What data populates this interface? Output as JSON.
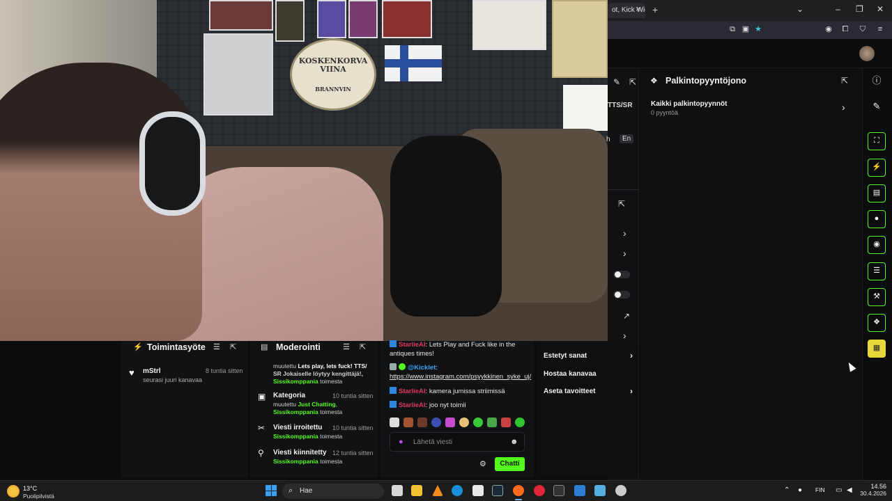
{
  "video": {
    "sign_line1": "KOSKENKORVA",
    "sign_line2": "VIINA",
    "sign_line3": "BRANNVIN"
  },
  "browser": {
    "tab_title": "ot, Kick Wich",
    "tab_close": "×",
    "new_tab": "+"
  },
  "left_strip": {
    "label_tts": "TTS/SR",
    "label_lang": "En",
    "label_h": "h"
  },
  "rewards": {
    "title": "Palkintopyyntöjono",
    "row_label": "Kaikki palkintopyynnöt",
    "row_count": "0 pyyntöä"
  },
  "activity": {
    "title": "Toimintasyöte",
    "items": [
      {
        "name": "mStrl",
        "text": "seurasi juuri kanavaa",
        "time": "8 tuntia sitten"
      }
    ]
  },
  "moderation": {
    "title": "Moderointi",
    "rows": [
      {
        "title": "",
        "time": "",
        "line1_prefix": "muutettu ",
        "line1_value": "Lets play, lets fuck! TTS/",
        "line2": "SR Jokaiselle löytyy kengittäjä!,",
        "line3_user": "Sissikomppania",
        "line3_suffix": " toimesta"
      },
      {
        "title": "Kategoria",
        "time": "10 tuntia sitten",
        "line1_prefix": "muutettu ",
        "line1_value": "Just Chatting",
        "line2": "",
        "line3_user": "Sissikomppania",
        "line3_suffix": " toimesta"
      },
      {
        "title": "Viesti irroitettu",
        "time": "10 tuntia sitten",
        "line1_prefix": "",
        "line1_value": "",
        "line2": "",
        "line3_user": "Sissikomppania",
        "line3_suffix": " toimesta"
      },
      {
        "title": "Viesti kiinnitetty",
        "time": "12 tuntia sitten",
        "line1_prefix": "",
        "line1_value": "",
        "line2": "",
        "line3_user": "Sissikomppania",
        "line3_suffix": " toimesta"
      }
    ]
  },
  "chat": {
    "messages": [
      {
        "user": "StarlieAI",
        "text": ": Lets Play and Fuck like in the antiques times!"
      },
      {
        "user": "@Kicklet",
        "text": ": ",
        "link": "https://www.instagram.com/psyykkinen_syke_uj/"
      },
      {
        "user": "StarlieAI",
        "text": ": kamera jumissa striimissä"
      },
      {
        "user": "StarlieAI",
        "text": ": joo nyt toimii"
      }
    ],
    "input_placeholder": "Lähetä viesti",
    "send_label": "Chatti"
  },
  "quick_actions": {
    "items": [
      {
        "label": "Estetyt sanat",
        "has_chevron": true
      },
      {
        "label": "Hostaa kanavaa",
        "has_chevron": false
      },
      {
        "label": "Aseta tavoitteet",
        "has_chevron": true
      }
    ]
  },
  "taskbar": {
    "weather_temp": "13°C",
    "weather_desc": "Puolipilvistä",
    "search_label": "Hae",
    "lang": "FIN",
    "time": "14.56",
    "date": "30.4.2026"
  },
  "colors": {
    "accent": "#53fc18",
    "chat_user": "#e0365f",
    "bot_user": "#3aa0f3"
  }
}
